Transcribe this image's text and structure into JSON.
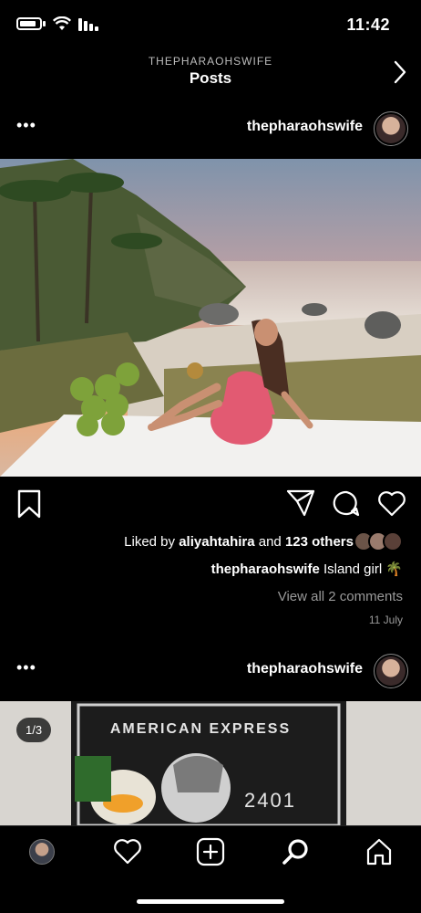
{
  "status": {
    "time": "11:42"
  },
  "header": {
    "subtitle": "THEPHARAOHSWIFE",
    "title": "Posts"
  },
  "post1": {
    "username": "thepharaohswife",
    "more": "•••",
    "liked_by_prefix": "Liked by ",
    "liked_by_user": "aliyahtahira",
    "liked_by_suffix": " and ",
    "liked_others": "123 others",
    "caption_user": "thepharaohswife",
    "caption_text": " Island girl 🌴",
    "view_comments": "View all 2 comments",
    "date": "11 July"
  },
  "post2": {
    "username": "thepharaohswife",
    "more": "•••",
    "counter": "1/3",
    "card_brand": "AMERICAN EXPRESS",
    "card_number": "2401"
  },
  "icons": {
    "back": "chevron-right-icon",
    "save": "bookmark-icon",
    "share": "send-icon",
    "comment": "comment-icon",
    "like": "heart-icon",
    "tabs": [
      "profile-avatar",
      "heart-icon",
      "add-post-icon",
      "search-icon",
      "home-icon"
    ]
  },
  "colors": {
    "background": "#000000",
    "text": "#ffffff",
    "muted": "#9a9a9a"
  }
}
